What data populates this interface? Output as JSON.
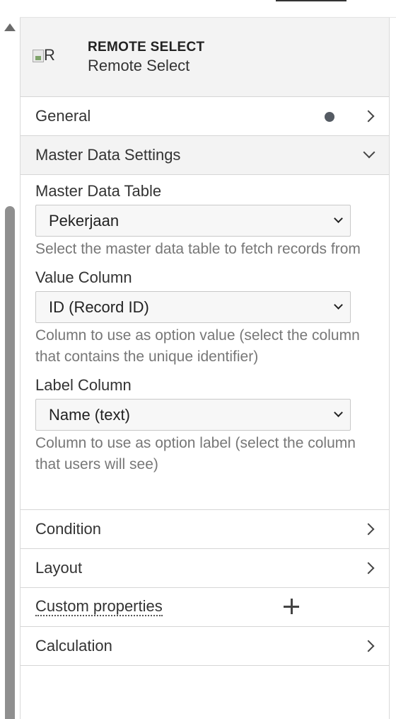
{
  "header": {
    "image_alt": "R",
    "title_upper": "REMOTE SELECT",
    "title_sub": "Remote Select"
  },
  "sections": {
    "general": "General",
    "master_data": "Master Data Settings",
    "condition": "Condition",
    "layout": "Layout",
    "custom_properties": "Custom properties",
    "calculation": "Calculation"
  },
  "master_data": {
    "table_label": "Master Data Table",
    "table_value": "Pekerjaan",
    "table_help": "Select the master data table to fetch records from",
    "value_label": "Value Column",
    "value_value": "ID (Record ID)",
    "value_help": "Column to use as option value (select the column that contains the unique identifier)",
    "label_label": "Label Column",
    "label_value": "Name (text)",
    "label_help": "Column to use as option label (select the column that users will see)"
  },
  "icons": {
    "general_status": "dot-indicator-icon",
    "expand": "chevron-right-icon",
    "collapse": "chevron-down-icon",
    "add": "plus-icon",
    "select": "chevron-down-icon"
  }
}
